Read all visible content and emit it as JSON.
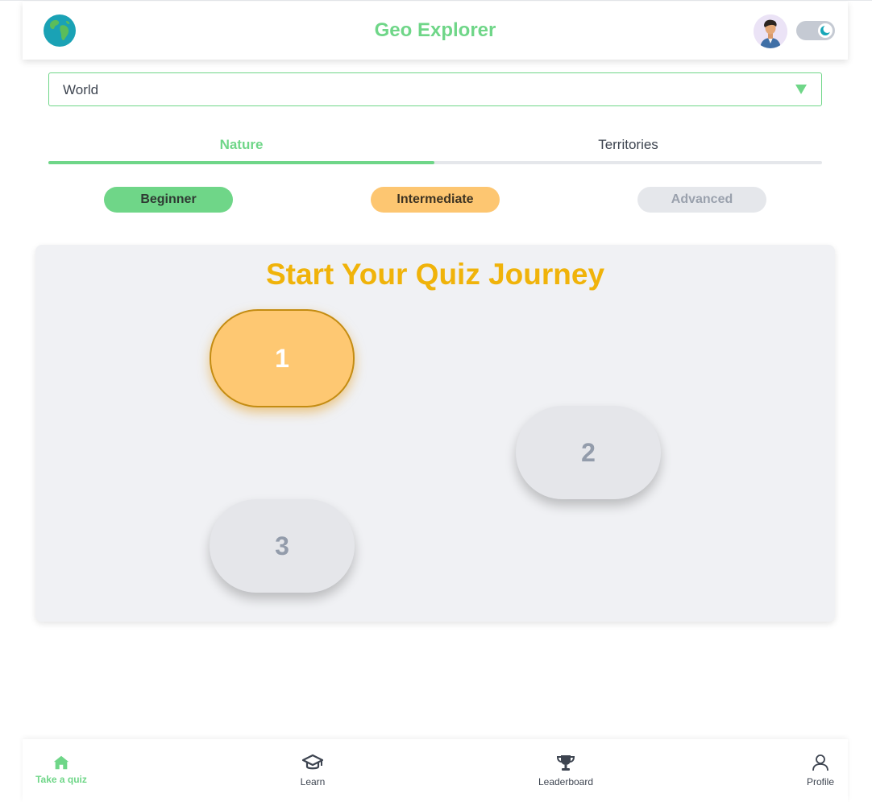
{
  "header": {
    "title": "Geo Explorer",
    "logo_icon": "globe-icon",
    "avatar_icon": "user-avatar",
    "theme_toggle": "dark-mode-toggle"
  },
  "region_select": {
    "value": "World"
  },
  "tabs": [
    {
      "label": "Nature",
      "active": true
    },
    {
      "label": "Territories",
      "active": false
    }
  ],
  "difficulty": [
    {
      "label": "Beginner",
      "color": "#6fd688"
    },
    {
      "label": "Intermediate",
      "color": "#fdc671"
    },
    {
      "label": "Advanced",
      "color": "#e5e7eb"
    }
  ],
  "quiz": {
    "title": "Start Your Quiz Journey",
    "levels": [
      {
        "label": "1",
        "state": "current"
      },
      {
        "label": "2",
        "state": "locked"
      },
      {
        "label": "3",
        "state": "locked"
      }
    ]
  },
  "bottom_nav": [
    {
      "label": "Take a quiz",
      "icon": "home-icon",
      "active": true
    },
    {
      "label": "Learn",
      "icon": "graduation-cap-icon",
      "active": false
    },
    {
      "label": "Leaderboard",
      "icon": "trophy-icon",
      "active": false
    },
    {
      "label": "Profile",
      "icon": "user-icon",
      "active": false
    }
  ],
  "colors": {
    "accent_green": "#6fd688",
    "accent_yellow": "#f0b30a",
    "accent_orange": "#fec872"
  }
}
